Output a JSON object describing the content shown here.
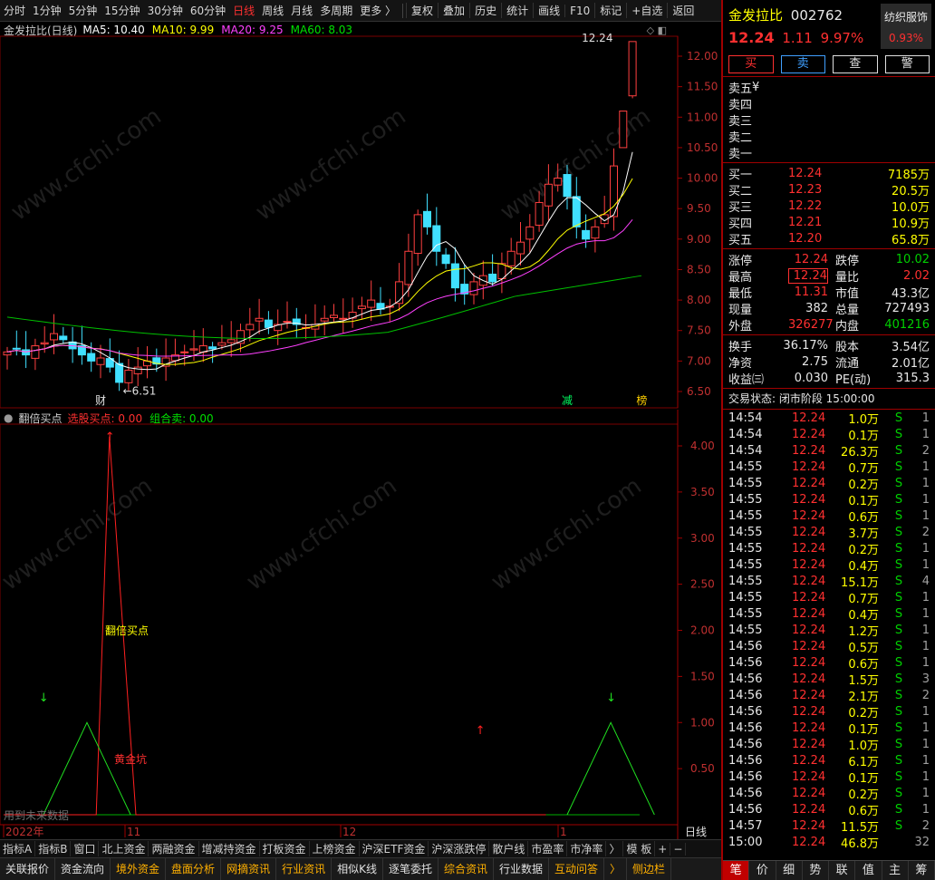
{
  "toolbar": {
    "periods": [
      "分时",
      "1分钟",
      "5分钟",
      "15分钟",
      "30分钟",
      "60分钟",
      "日线",
      "周线",
      "月线",
      "多周期",
      "更多 〉"
    ],
    "active_period": "日线",
    "tools": [
      "复权",
      "叠加",
      "历史",
      "统计",
      "画线",
      "F10",
      "标记",
      "+自选",
      "返回"
    ]
  },
  "main_chart": {
    "title": "金发拉比(日线)",
    "ma": [
      {
        "label": "MA5: 10.40",
        "color": "#ffffff"
      },
      {
        "label": "MA10: 9.99",
        "color": "#ffff00"
      },
      {
        "label": "MA20: 9.25",
        "color": "#ff40ff"
      },
      {
        "label": "MA60: 8.03",
        "color": "#00e000"
      }
    ],
    "price_axis": [
      "12.00",
      "11.50",
      "11.00",
      "10.50",
      "10.00",
      "9.50",
      "9.00",
      "8.50",
      "8.00",
      "7.50",
      "7.00",
      "6.50"
    ],
    "high_label": "12.24",
    "low_label": "6.51",
    "markers": [
      "财",
      "减",
      "榜"
    ]
  },
  "sub_chart": {
    "indicator_name": "翻倍买点",
    "values": [
      {
        "label": "选股买点: 0.00",
        "color": "#ff3030"
      },
      {
        "label": "组合卖: 0.00",
        "color": "#00e000"
      }
    ],
    "axis": [
      "4.00",
      "3.50",
      "3.00",
      "2.50",
      "2.00",
      "1.50",
      "1.00",
      "0.50"
    ],
    "annot_buy": "翻倍买点",
    "annot_gold": "黄金坑",
    "future_note": "用到未来数据",
    "date_labels": [
      "2022年",
      "11",
      "12",
      "1"
    ],
    "period_tag": "日线"
  },
  "chart_data": {
    "type": "line",
    "title": "翻倍买点",
    "series": [
      {
        "name": "选股买点",
        "x": [
          0,
          5,
          7,
          8,
          10,
          31,
          32,
          40,
          41
        ],
        "values": [
          0,
          0,
          0,
          4.1,
          0,
          0,
          0,
          0,
          0
        ]
      },
      {
        "name": "组合卖",
        "x": [
          1,
          2,
          3,
          13,
          14,
          15,
          21,
          22,
          23
        ],
        "values": [
          0,
          1,
          0,
          0,
          1,
          0,
          0,
          1,
          0
        ]
      }
    ],
    "ylim": [
      0,
      4.3
    ]
  },
  "tabs_row1": [
    "指标A",
    "指标B",
    "窗口",
    "北上资金",
    "两融资金",
    "增减持资金",
    "打板资金",
    "上榜资金",
    "沪深ETF资金",
    "沪深涨跌停",
    "散户线",
    "市盈率",
    "市净率",
    "〉",
    "模 板",
    "+",
    "−"
  ],
  "tabs_row2": [
    {
      "label": "关联报价",
      "orange": false
    },
    {
      "label": "资金流向",
      "orange": false
    },
    {
      "label": "境外资金",
      "orange": true
    },
    {
      "label": "盘面分析",
      "orange": true
    },
    {
      "label": "网摘资讯",
      "orange": true
    },
    {
      "label": "行业资讯",
      "orange": true
    },
    {
      "label": "相似K线",
      "orange": false
    },
    {
      "label": "逐笔委托",
      "orange": false
    },
    {
      "label": "综合资讯",
      "orange": true
    },
    {
      "label": "行业数据",
      "orange": false
    },
    {
      "label": "互动问答",
      "orange": true
    },
    {
      "label": "〉",
      "orange": true
    },
    {
      "label": "侧边栏",
      "orange": true
    }
  ],
  "quote": {
    "name": "金发拉比",
    "code": "002762",
    "industry": "纺织服饰",
    "industry_pct": "0.93%",
    "price": "12.24",
    "change": "1.11",
    "change_pct": "9.97%",
    "buttons": [
      "买",
      "卖",
      "查",
      "警"
    ],
    "sells": [
      {
        "label": "卖五",
        "price": "¥",
        "vol": ""
      },
      {
        "label": "卖四",
        "price": "",
        "vol": ""
      },
      {
        "label": "卖三",
        "price": "",
        "vol": ""
      },
      {
        "label": "卖二",
        "price": "",
        "vol": ""
      },
      {
        "label": "卖一",
        "price": "",
        "vol": ""
      }
    ],
    "buys": [
      {
        "label": "买一",
        "price": "12.24",
        "vol": "7185万"
      },
      {
        "label": "买二",
        "price": "12.23",
        "vol": "20.5万"
      },
      {
        "label": "买三",
        "price": "12.22",
        "vol": "10.0万"
      },
      {
        "label": "买四",
        "price": "12.21",
        "vol": "10.9万"
      },
      {
        "label": "买五",
        "price": "12.20",
        "vol": "65.8万"
      }
    ],
    "stats": [
      {
        "l1": "涨停",
        "v1": "12.24",
        "c1": "red",
        "l2": "跌停",
        "v2": "10.02",
        "c2": "green"
      },
      {
        "l1": "最高",
        "v1": "12.24",
        "c1": "red",
        "l2": "量比",
        "v2": "2.02",
        "c2": "red"
      },
      {
        "l1": "最低",
        "v1": "11.31",
        "c1": "red",
        "l2": "市值",
        "v2": "43.3亿",
        "c2": "white"
      },
      {
        "l1": "现量",
        "v1": "382",
        "c1": "white",
        "l2": "总量",
        "v2": "727493",
        "c2": "white"
      },
      {
        "l1": "外盘",
        "v1": "326277",
        "c1": "red",
        "l2": "内盘",
        "v2": "401216",
        "c2": "green"
      }
    ],
    "stats2": [
      {
        "l1": "换手",
        "v1": "36.17%",
        "l2": "股本",
        "v2": "3.54亿"
      },
      {
        "l1": "净资",
        "v1": "2.75",
        "l2": "流通",
        "v2": "2.01亿"
      },
      {
        "l1": "收益㈢",
        "v1": "0.030",
        "l2": "PE(动)",
        "v2": "315.3"
      }
    ],
    "status": "交易状态: 闭市阶段 15:00:00",
    "ticks": [
      {
        "t": "14:54",
        "p": "12.24",
        "v": "1.0万",
        "s": "S",
        "n": "1"
      },
      {
        "t": "14:54",
        "p": "12.24",
        "v": "0.1万",
        "s": "S",
        "n": "1"
      },
      {
        "t": "14:54",
        "p": "12.24",
        "v": "26.3万",
        "s": "S",
        "n": "2"
      },
      {
        "t": "14:55",
        "p": "12.24",
        "v": "0.7万",
        "s": "S",
        "n": "1"
      },
      {
        "t": "14:55",
        "p": "12.24",
        "v": "0.2万",
        "s": "S",
        "n": "1"
      },
      {
        "t": "14:55",
        "p": "12.24",
        "v": "0.1万",
        "s": "S",
        "n": "1"
      },
      {
        "t": "14:55",
        "p": "12.24",
        "v": "0.6万",
        "s": "S",
        "n": "1"
      },
      {
        "t": "14:55",
        "p": "12.24",
        "v": "3.7万",
        "s": "S",
        "n": "2"
      },
      {
        "t": "14:55",
        "p": "12.24",
        "v": "0.2万",
        "s": "S",
        "n": "1"
      },
      {
        "t": "14:55",
        "p": "12.24",
        "v": "0.4万",
        "s": "S",
        "n": "1"
      },
      {
        "t": "14:55",
        "p": "12.24",
        "v": "15.1万",
        "s": "S",
        "n": "4"
      },
      {
        "t": "14:55",
        "p": "12.24",
        "v": "0.7万",
        "s": "S",
        "n": "1"
      },
      {
        "t": "14:55",
        "p": "12.24",
        "v": "0.4万",
        "s": "S",
        "n": "1"
      },
      {
        "t": "14:55",
        "p": "12.24",
        "v": "1.2万",
        "s": "S",
        "n": "1"
      },
      {
        "t": "14:56",
        "p": "12.24",
        "v": "0.5万",
        "s": "S",
        "n": "1"
      },
      {
        "t": "14:56",
        "p": "12.24",
        "v": "0.6万",
        "s": "S",
        "n": "1"
      },
      {
        "t": "14:56",
        "p": "12.24",
        "v": "1.5万",
        "s": "S",
        "n": "3"
      },
      {
        "t": "14:56",
        "p": "12.24",
        "v": "2.1万",
        "s": "S",
        "n": "2"
      },
      {
        "t": "14:56",
        "p": "12.24",
        "v": "0.2万",
        "s": "S",
        "n": "1"
      },
      {
        "t": "14:56",
        "p": "12.24",
        "v": "0.1万",
        "s": "S",
        "n": "1"
      },
      {
        "t": "14:56",
        "p": "12.24",
        "v": "1.0万",
        "s": "S",
        "n": "1"
      },
      {
        "t": "14:56",
        "p": "12.24",
        "v": "6.1万",
        "s": "S",
        "n": "1"
      },
      {
        "t": "14:56",
        "p": "12.24",
        "v": "0.1万",
        "s": "S",
        "n": "1"
      },
      {
        "t": "14:56",
        "p": "12.24",
        "v": "0.2万",
        "s": "S",
        "n": "1"
      },
      {
        "t": "14:56",
        "p": "12.24",
        "v": "0.6万",
        "s": "S",
        "n": "1"
      },
      {
        "t": "14:57",
        "p": "12.24",
        "v": "11.5万",
        "s": "S",
        "n": "2"
      },
      {
        "t": "15:00",
        "p": "12.24",
        "v": "46.8万",
        "s": "",
        "n": "32"
      }
    ],
    "bottom_tabs": [
      "笔",
      "价",
      "细",
      "势",
      "联",
      "值",
      "主",
      "筹"
    ]
  }
}
